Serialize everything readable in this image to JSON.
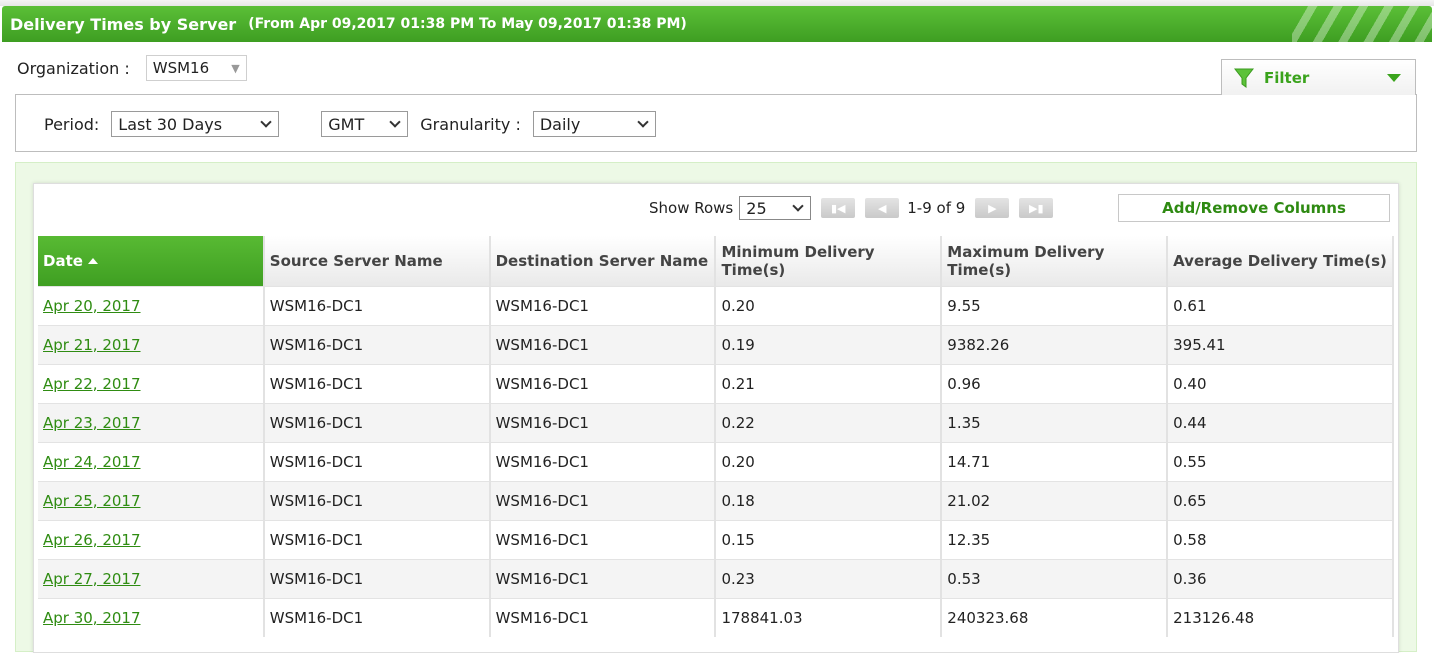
{
  "header": {
    "title": "Delivery Times by Server",
    "range": "(From Apr 09,2017 01:38 PM To May 09,2017 01:38 PM)"
  },
  "organization": {
    "label": "Organization :",
    "value": "WSM16"
  },
  "filter": {
    "label": "Filter"
  },
  "period": {
    "label": "Period:",
    "value": "Last 30 Days",
    "timezone": "GMT",
    "granularity_label": "Granularity :",
    "granularity": "Daily"
  },
  "pager": {
    "show_rows_label": "Show Rows",
    "rows_value": "25",
    "range_text": "1-9 of 9",
    "add_remove_label": "Add/Remove Columns"
  },
  "columns": [
    "Date",
    "Source Server Name",
    "Destination Server Name",
    "Minimum Delivery Time(s)",
    "Maximum Delivery Time(s)",
    "Average Delivery Time(s)"
  ],
  "rows": [
    [
      "Apr 20, 2017",
      "WSM16-DC1",
      "WSM16-DC1",
      "0.20",
      "9.55",
      "0.61"
    ],
    [
      "Apr 21, 2017",
      "WSM16-DC1",
      "WSM16-DC1",
      "0.19",
      "9382.26",
      "395.41"
    ],
    [
      "Apr 22, 2017",
      "WSM16-DC1",
      "WSM16-DC1",
      "0.21",
      "0.96",
      "0.40"
    ],
    [
      "Apr 23, 2017",
      "WSM16-DC1",
      "WSM16-DC1",
      "0.22",
      "1.35",
      "0.44"
    ],
    [
      "Apr 24, 2017",
      "WSM16-DC1",
      "WSM16-DC1",
      "0.20",
      "14.71",
      "0.55"
    ],
    [
      "Apr 25, 2017",
      "WSM16-DC1",
      "WSM16-DC1",
      "0.18",
      "21.02",
      "0.65"
    ],
    [
      "Apr 26, 2017",
      "WSM16-DC1",
      "WSM16-DC1",
      "0.15",
      "12.35",
      "0.58"
    ],
    [
      "Apr 27, 2017",
      "WSM16-DC1",
      "WSM16-DC1",
      "0.23",
      "0.53",
      "0.36"
    ],
    [
      "Apr 30, 2017",
      "WSM16-DC1",
      "WSM16-DC1",
      "178841.03",
      "240323.68",
      "213126.48"
    ]
  ],
  "colors": {
    "accent": "#4caf2b",
    "link": "#2f8c12"
  }
}
